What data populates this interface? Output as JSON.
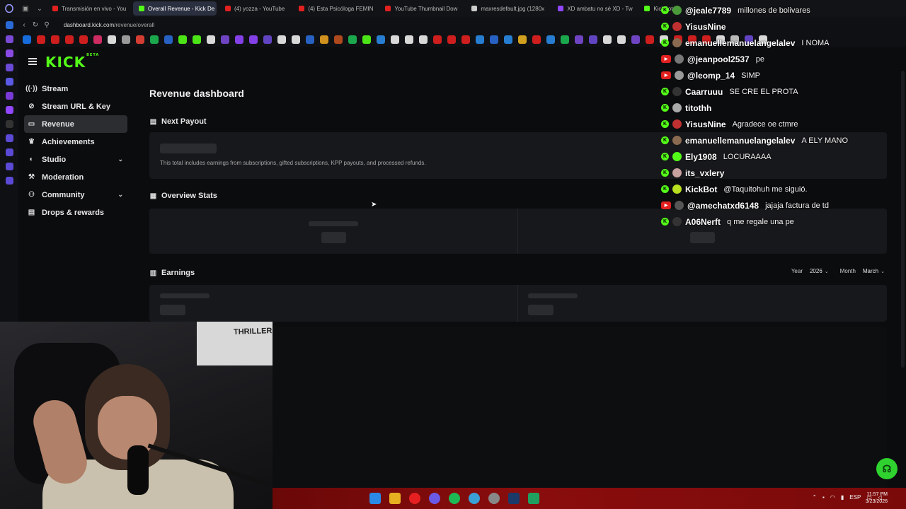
{
  "browser": {
    "tabs": [
      {
        "label": "Transmisión en vivo - You",
        "color": "#e32020",
        "active": false
      },
      {
        "label": "Overall Revenue - Kick De",
        "color": "#53fc18",
        "active": true
      },
      {
        "label": "(4) yozza - YouTube",
        "color": "#e32020",
        "active": false
      },
      {
        "label": "(4) Esta Psicóloga FEMIN",
        "color": "#e32020",
        "active": false
      },
      {
        "label": "YouTube Thumbnail Dow",
        "color": "#e32020",
        "active": false
      },
      {
        "label": "maxresdefault.jpg (1280x",
        "color": "#cccccc",
        "active": false
      },
      {
        "label": "XD ambatu no sé XD - Tw",
        "color": "#9146ff",
        "active": false
      },
      {
        "label": "KickBot",
        "color": "#53fc18",
        "active": false
      }
    ],
    "url_domain": "dashboard.kick.com",
    "url_path": "/revenue/overall"
  },
  "kick": {
    "logo": "KICK",
    "logo_badge": "BETA"
  },
  "sidebar": {
    "items": [
      {
        "label": "Stream",
        "icon": "broadcast-icon",
        "glyph": "((·))",
        "active": false,
        "expand": false
      },
      {
        "label": "Stream URL & Key",
        "icon": "link-icon",
        "glyph": "⊘",
        "active": false,
        "expand": false
      },
      {
        "label": "Revenue",
        "icon": "wallet-icon",
        "glyph": "▭",
        "active": true,
        "expand": false
      },
      {
        "label": "Achievements",
        "icon": "trophy-icon",
        "glyph": "♛",
        "active": false,
        "expand": false
      },
      {
        "label": "Studio",
        "icon": "palette-icon",
        "glyph": "◐",
        "active": false,
        "expand": true
      },
      {
        "label": "Moderation",
        "icon": "wrench-icon",
        "glyph": "⚒",
        "active": false,
        "expand": false
      },
      {
        "label": "Community",
        "icon": "people-icon",
        "glyph": "⚇",
        "active": false,
        "expand": true
      },
      {
        "label": "Drops & rewards",
        "icon": "gift-icon",
        "glyph": "▤",
        "active": false,
        "expand": false
      }
    ]
  },
  "main": {
    "title": "Revenue dashboard",
    "next_payout": {
      "title": "Next Payout",
      "note": "This total includes earnings from subscriptions, gifted subscriptions, KPP payouts, and processed refunds."
    },
    "overview": {
      "title": "Overview Stats"
    },
    "earnings": {
      "title": "Earnings",
      "year_label": "Year",
      "year_value": "2026",
      "month_label": "Month",
      "month_value": "March"
    }
  },
  "chat": [
    {
      "platform": "kick",
      "user": "@jeale7789",
      "msg": "millones de bolivares",
      "avatar": "#4a9a3a"
    },
    {
      "platform": "kick",
      "user": "YisusNine",
      "msg": "",
      "avatar": "#c03030"
    },
    {
      "platform": "kick",
      "user": "emanuellemanuelangelalev",
      "msg": "I NOMA",
      "avatar": "#8a6a50"
    },
    {
      "platform": "yt",
      "user": "@jeanpool2537",
      "msg": "pe",
      "avatar": "#777777"
    },
    {
      "platform": "yt",
      "user": "@leomp_14",
      "msg": "SIMP",
      "avatar": "#999999"
    },
    {
      "platform": "kick",
      "user": "Caarruuu",
      "msg": "SE CRE EL PROTA",
      "avatar": "#333333"
    },
    {
      "platform": "kick",
      "user": "titothh",
      "msg": "",
      "avatar": "#aaaaaa"
    },
    {
      "platform": "kick",
      "user": "YisusNine",
      "msg": "Agradece oe ctmre",
      "avatar": "#c03030"
    },
    {
      "platform": "kick",
      "user": "emanuellemanuelangelalev",
      "msg": "A ELY MANO",
      "avatar": "#8a6a50"
    },
    {
      "platform": "kick",
      "user": "Ely1908",
      "msg": "LOCURAAAA",
      "avatar": "#53fc18"
    },
    {
      "platform": "kick",
      "user": "its_vxlery",
      "msg": "",
      "avatar": "#c8a0a0"
    },
    {
      "platform": "kick",
      "user": "KickBot",
      "msg": "@Taquitohuh me siguió.",
      "avatar": "#b8e020"
    },
    {
      "platform": "yt",
      "user": "@amechatxd6148",
      "msg": "jajaja factura de td",
      "avatar": "#555555"
    },
    {
      "platform": "kick",
      "user": "A06Nerft",
      "msg": "q me regale una pe",
      "avatar": "#333333"
    }
  ],
  "webcam": {
    "poster_text": "THRILLER"
  },
  "taskbar": {
    "lang": "ESP",
    "time": "11:57 PM",
    "date": "3/23/2026"
  },
  "colors": {
    "kick_green": "#53fc18",
    "background": "#0b0c0e",
    "card": "#17181b"
  }
}
